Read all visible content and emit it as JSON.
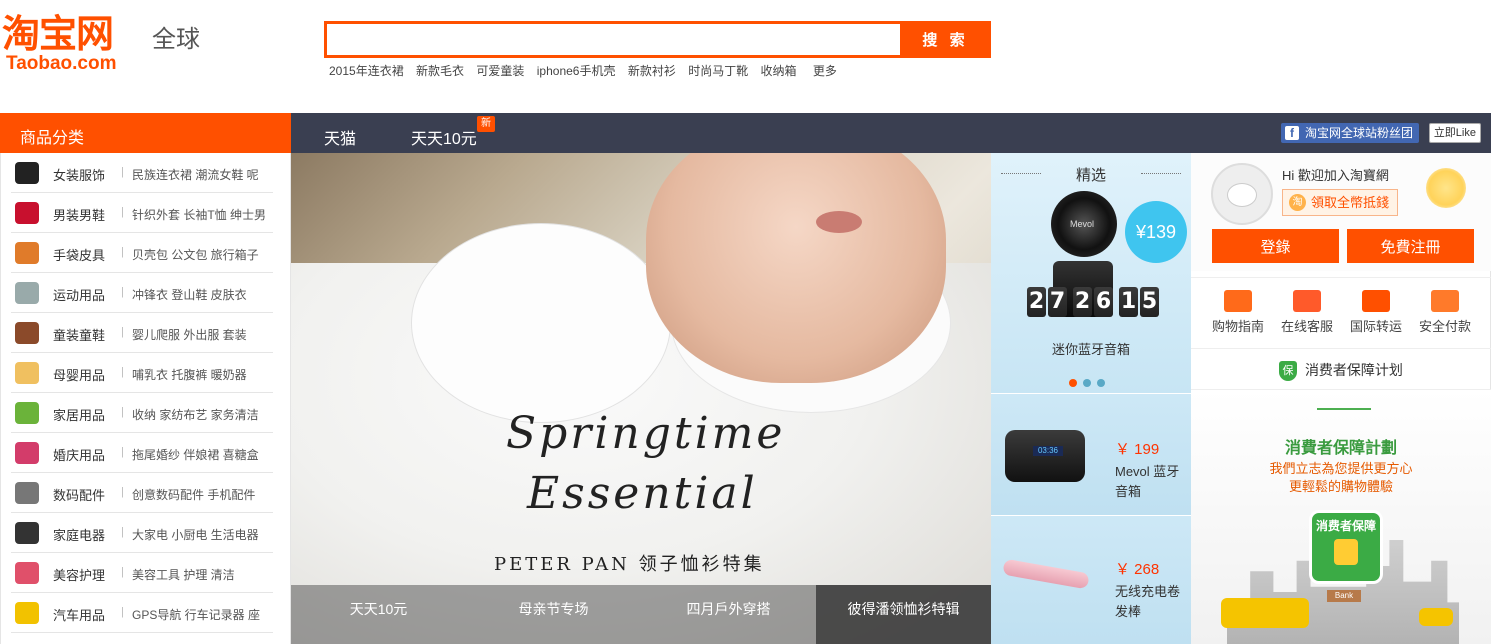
{
  "header": {
    "logo_main": "淘宝网",
    "logo_sub": "Taobao.com",
    "logo_global": "全球",
    "search_placeholder": "",
    "search_button": "搜 索",
    "hot_keywords": [
      "2015年连衣裙",
      "新款毛衣",
      "可爱童装",
      "iphone6手机壳",
      "新款衬衫",
      "时尚马丁靴",
      "收纳箱",
      "更多"
    ]
  },
  "nav": {
    "category_header": "商品分类",
    "tmall": "天猫",
    "tiantian": "天天10元",
    "new_badge": "新",
    "fb_fanpage": "淘宝网全球站粉丝团",
    "fb_icon": "f",
    "fb_like": "立即Like"
  },
  "categories": [
    {
      "name": "女装服饰",
      "icon": "dress-icon",
      "sub": "民族连衣裙 潮流女鞋 呢"
    },
    {
      "name": "男装男鞋",
      "icon": "sneaker-icon",
      "sub": "针织外套 长袖T恤 绅士男"
    },
    {
      "name": "手袋皮具",
      "icon": "handbag-icon",
      "sub": "贝壳包 公文包 旅行箱子"
    },
    {
      "name": "运动用品",
      "icon": "shuttlecock-icon",
      "sub": "冲锋衣 登山鞋 皮肤衣"
    },
    {
      "name": "童装童鞋",
      "icon": "kids-shoe-icon",
      "sub": "婴儿爬服 外出服 套装"
    },
    {
      "name": "母婴用品",
      "icon": "baby-bottle-icon",
      "sub": "哺乳衣 托腹裤 暖奶器"
    },
    {
      "name": "家居用品",
      "icon": "cup-icon",
      "sub": "收纳 家纺布艺 家务清洁"
    },
    {
      "name": "婚庆用品",
      "icon": "flower-icon",
      "sub": "拖尾婚纱 伴娘裙 喜糖盒"
    },
    {
      "name": "数码配件",
      "icon": "camera-icon",
      "sub": "创意数码配件 手机配件"
    },
    {
      "name": "家庭电器",
      "icon": "kettle-icon",
      "sub": "大家电 小厨电 生活电器"
    },
    {
      "name": "美容护理",
      "icon": "compact-icon",
      "sub": "美容工具 护理 清洁"
    },
    {
      "name": "汽车用品",
      "icon": "car-icon",
      "sub": "GPS导航 行车记录器 座"
    }
  ],
  "banner": {
    "title_line1": "Springtime",
    "title_line2": "Essential",
    "subtitle": "PETER PAN 领子恤衫特集",
    "tabs": [
      "天天10元",
      "母亲节专场",
      "四月戶外穿搭",
      "彼得潘领恤衫特辑"
    ],
    "active_tab": 3
  },
  "featured": {
    "title": "精选",
    "price": "¥139",
    "speaker_brand": "Mevol",
    "countdown": [
      "2",
      "7",
      "2",
      "6",
      "1",
      "5"
    ],
    "name": "迷你蓝牙音箱",
    "dots": 3,
    "active_dot": 0,
    "products": [
      {
        "price": "￥ 199",
        "name": "Mevol 蓝牙音箱",
        "screen": "03:36"
      },
      {
        "price": "￥ 268",
        "name": "无线充电卷发棒"
      }
    ]
  },
  "user": {
    "welcome": "Hi 歡迎加入淘寶網",
    "coupon_icon": "淘",
    "coupon": "領取全幣抵錢",
    "login": "登錄",
    "register": "免費注冊"
  },
  "services": [
    {
      "label": "购物指南",
      "icon": "guide-icon",
      "color": "#ff6a1a"
    },
    {
      "label": "在线客服",
      "icon": "chat-icon",
      "color": "#ff5a2a"
    },
    {
      "label": "国际转运",
      "icon": "truck-icon",
      "color": "#ff5000"
    },
    {
      "label": "安全付款",
      "icon": "lock-icon",
      "color": "#ff7a2a"
    }
  ],
  "guarantee": {
    "shield": "保",
    "row_label": "消费者保障计划",
    "title": "消費者保障計劃",
    "line1": "我們立志為您提供更方心",
    "line2": "更輕鬆的購物體驗",
    "badge": "消费者保障",
    "bank": "Bank"
  }
}
